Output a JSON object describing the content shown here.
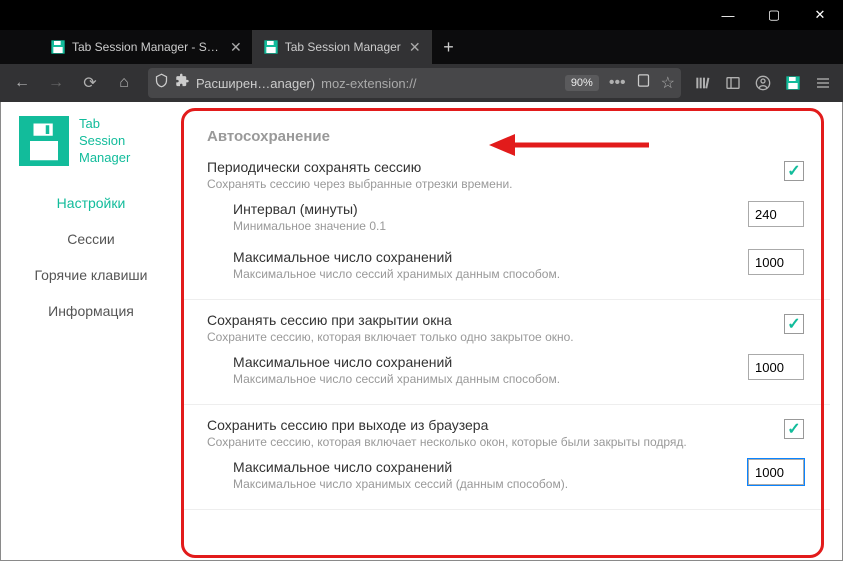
{
  "window": {
    "minimize": "—",
    "maximize": "▢",
    "close": "✕"
  },
  "tabs": [
    {
      "title": "Tab Session Manager - Sess",
      "active": false
    },
    {
      "title": "Tab Session Manager",
      "active": true
    }
  ],
  "toolbar": {
    "ext_label": "Расширен…anager)",
    "url": "moz-extension://",
    "zoom": "90%",
    "dots": "•••"
  },
  "app": {
    "name_line1": "Tab",
    "name_line2": "Session",
    "name_line3": "Manager"
  },
  "nav": {
    "settings": "Настройки",
    "sessions": "Сессии",
    "hotkeys": "Горячие клавиши",
    "info": "Информация"
  },
  "section_title": "Автосохранение",
  "s1": {
    "label": "Периодически сохранять сессию",
    "desc": "Сохранять сессию через выбранные отрезки времени.",
    "sub1_label": "Интервал (минуты)",
    "sub1_desc": "Минимальное значение 0.1",
    "sub1_value": "240",
    "sub2_label": "Максимальное число сохранений",
    "sub2_desc": "Максимальное число сессий хранимых данным способом.",
    "sub2_value": "1000"
  },
  "s2": {
    "label": "Сохранять сессию при закрытии окна",
    "desc": "Сохраните сессию, которая включает только одно закрытое окно.",
    "sub1_label": "Максимальное число сохранений",
    "sub1_desc": "Максимальное число сессий хранимых данным способом.",
    "sub1_value": "1000"
  },
  "s3": {
    "label": "Сохранить сессию при выходе из браузера",
    "desc": "Сохраните сессию, которая включает несколько окон, которые были закрыты подряд.",
    "sub1_label": "Максимальное число сохранений",
    "sub1_desc": "Максимальное число хранимых сессий (данным способом).",
    "sub1_value": "1000"
  }
}
